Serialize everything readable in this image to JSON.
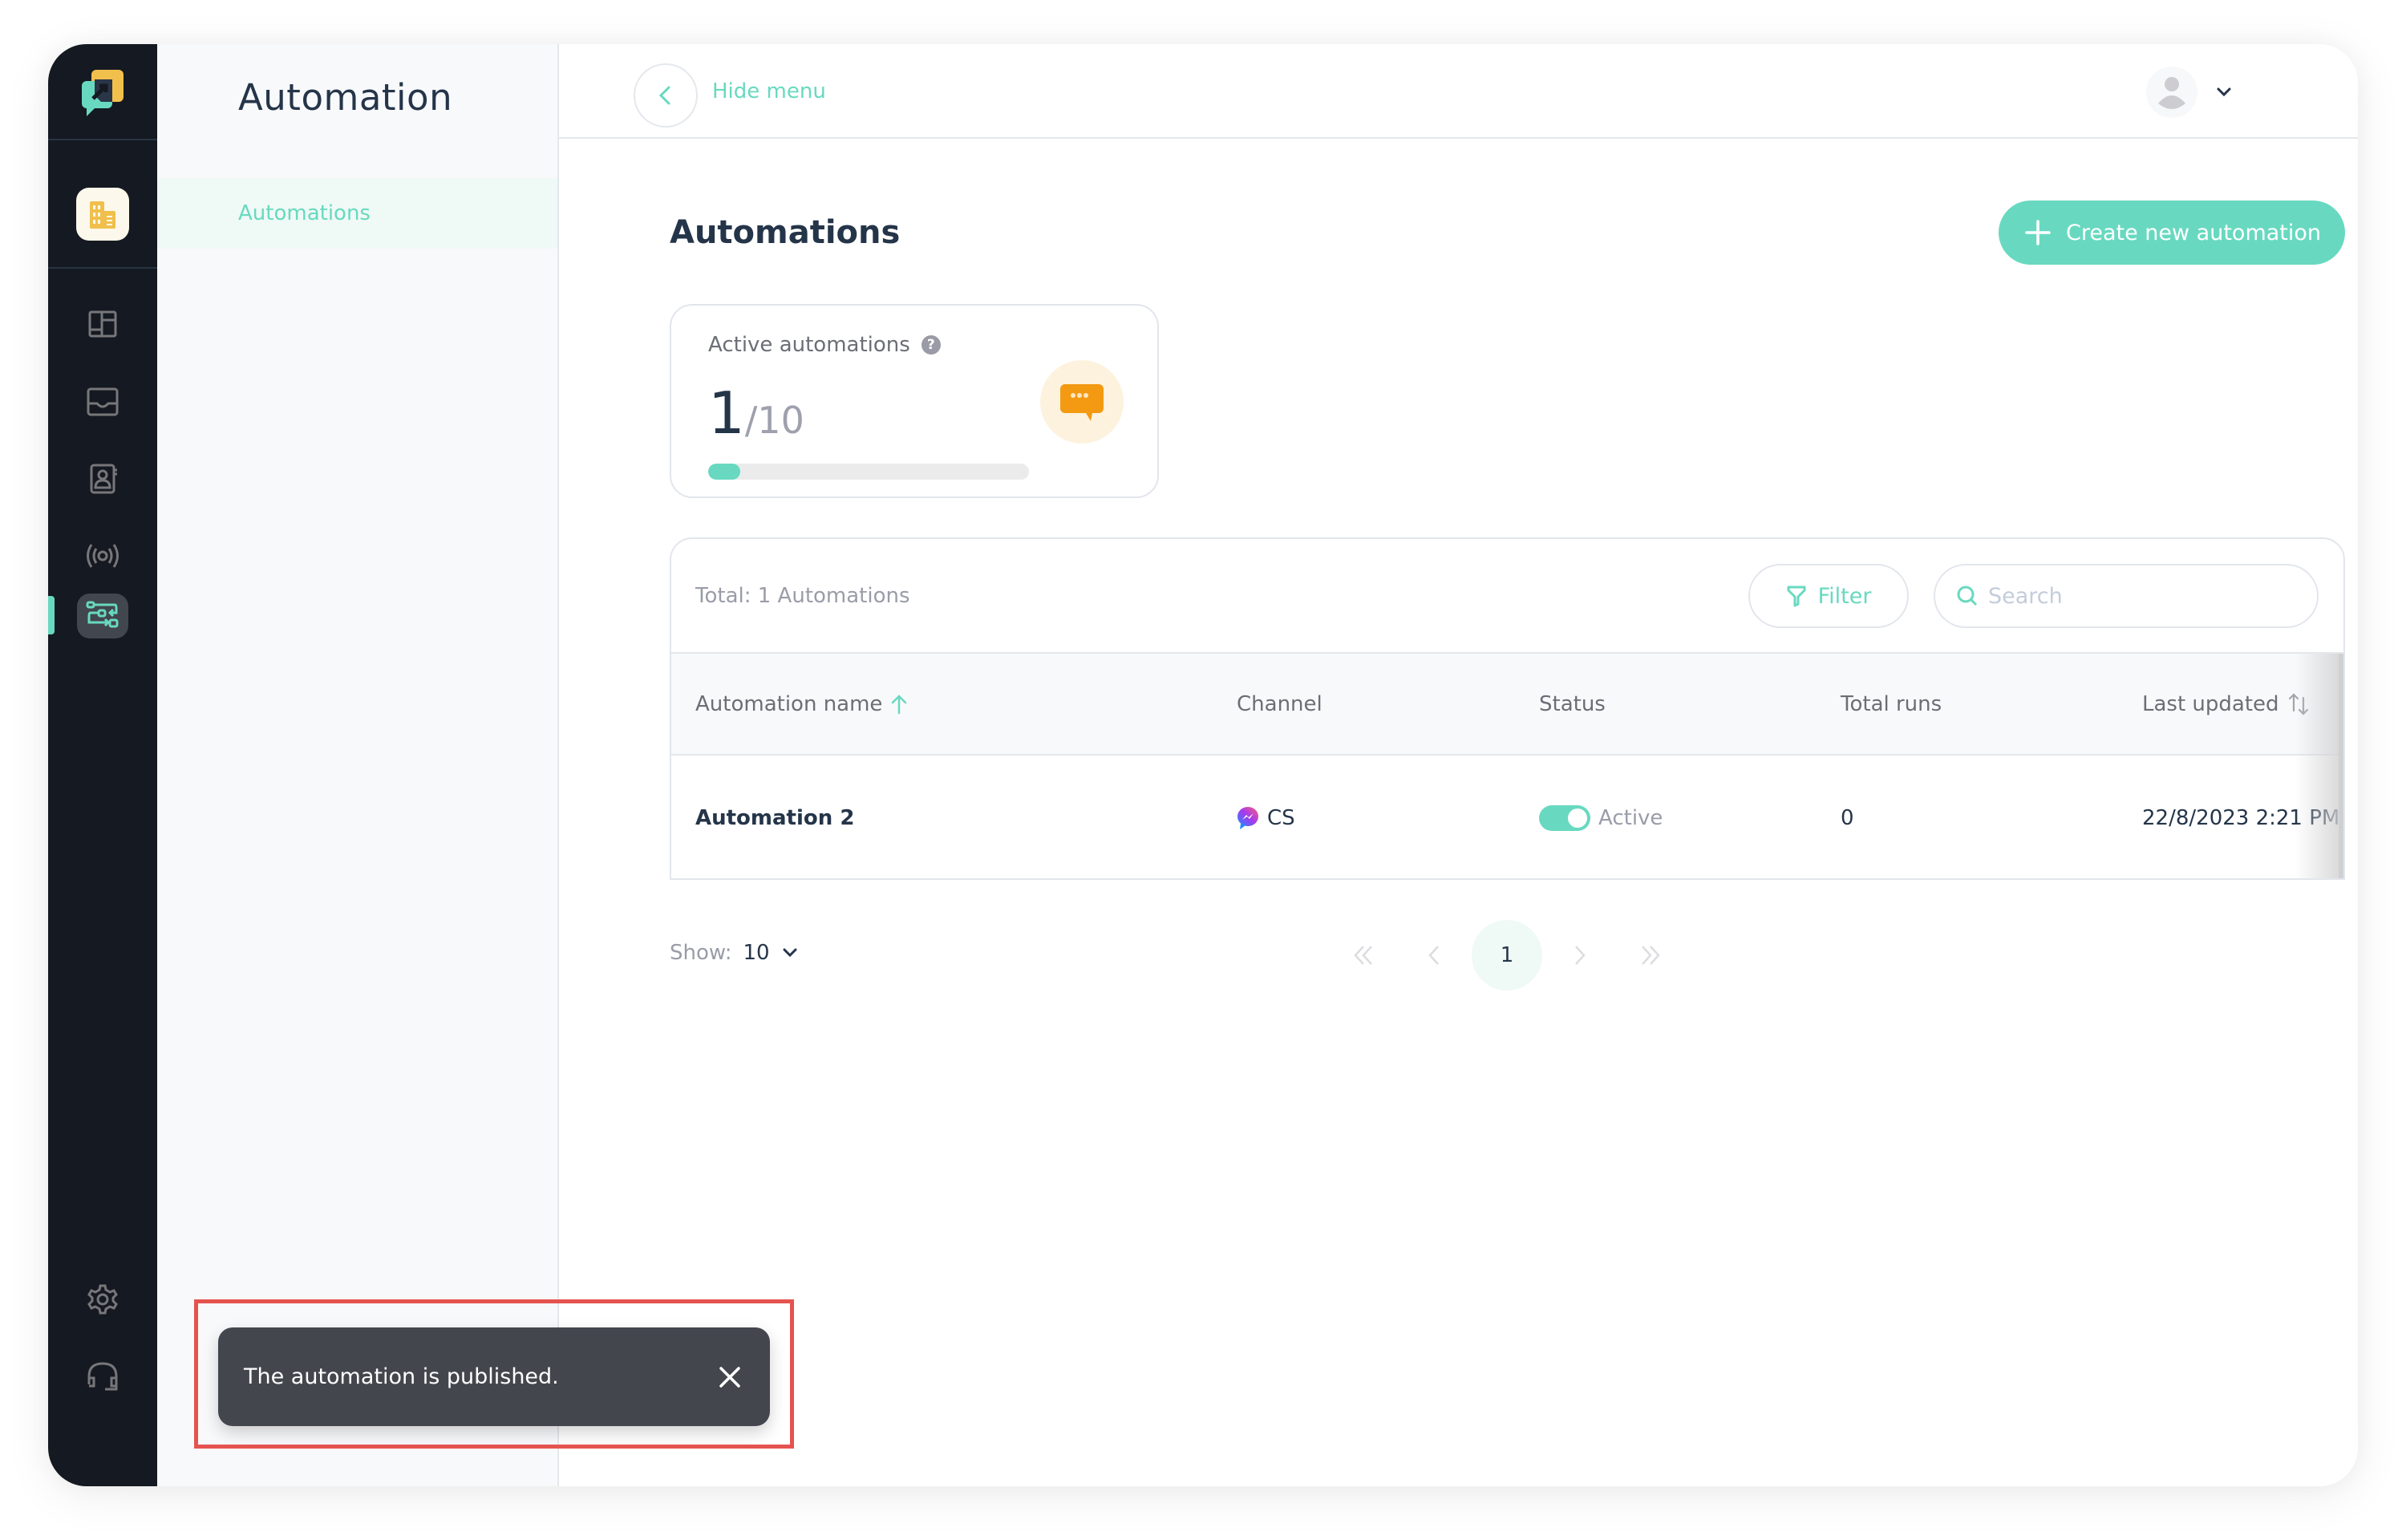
{
  "app": {
    "section_title": "Automation",
    "brand_colors": {
      "accent": "#68d9c0",
      "rail": "#151921",
      "text": "#253549"
    }
  },
  "rail": {
    "items": [
      {
        "icon": "workspace-building-icon",
        "label": "Workspace"
      },
      {
        "icon": "dashboard-icon",
        "label": "Dashboard"
      },
      {
        "icon": "inbox-icon",
        "label": "Inbox"
      },
      {
        "icon": "contacts-icon",
        "label": "Contacts"
      },
      {
        "icon": "broadcast-icon",
        "label": "Broadcast"
      },
      {
        "icon": "automation-flow-icon",
        "label": "Automation",
        "active": true
      },
      {
        "icon": "gear-icon",
        "label": "Settings"
      },
      {
        "icon": "headset-icon",
        "label": "Support"
      }
    ]
  },
  "subnav": {
    "title": "Automation",
    "items": [
      {
        "label": "Automations",
        "active": true
      }
    ]
  },
  "topbar": {
    "hide_menu_label": "Hide menu"
  },
  "page": {
    "title": "Automations",
    "create_button_label": "Create new automation"
  },
  "summary": {
    "label": "Active automations",
    "help_glyph": "?",
    "current": "1",
    "max": "/10",
    "progress_fraction": 0.1
  },
  "table": {
    "total_label": "Total: 1 Automations",
    "filter_label": "Filter",
    "search_placeholder": "Search",
    "search_value": "",
    "columns": [
      {
        "label": "Automation name",
        "sort": "asc"
      },
      {
        "label": "Channel"
      },
      {
        "label": "Status"
      },
      {
        "label": "Total runs"
      },
      {
        "label": "Last updated",
        "sort": "both"
      }
    ],
    "rows": [
      {
        "name": "Automation 2",
        "channel": "CS",
        "channel_icon": "messenger-icon",
        "status": "Active",
        "status_on": true,
        "total_runs": "0",
        "last_updated": "22/8/2023 2:21 PM"
      }
    ]
  },
  "pagination": {
    "show_label": "Show:",
    "page_size": "10",
    "current_page": "1"
  },
  "toast": {
    "message": "The automation is published."
  }
}
